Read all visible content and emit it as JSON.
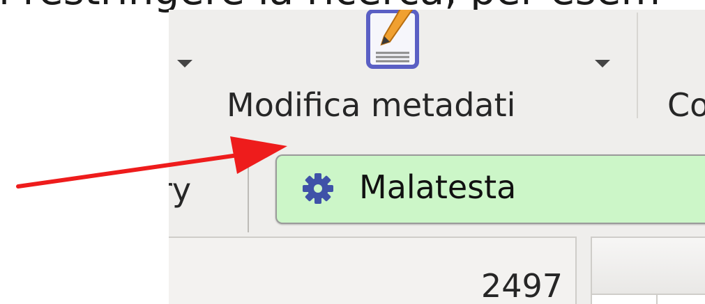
{
  "caption": {
    "text": "i restringere la ricerca, per esem"
  },
  "toolbar": {
    "edit_metadata_label": "Modifica metadati",
    "next_label_partial": "Co",
    "icons": [
      "dropdown-arrow-icon",
      "edit-metadata-icon",
      "dropdown-arrow-icon"
    ]
  },
  "tabs": {
    "previous_tab_partial": "ry",
    "search_chip": {
      "label": "Malatesta",
      "icon": "gear-icon",
      "color": "#ccf6c8"
    }
  },
  "panel": {
    "count": "2497"
  },
  "annotation": {
    "arrow_color": "#ee1c1c"
  }
}
